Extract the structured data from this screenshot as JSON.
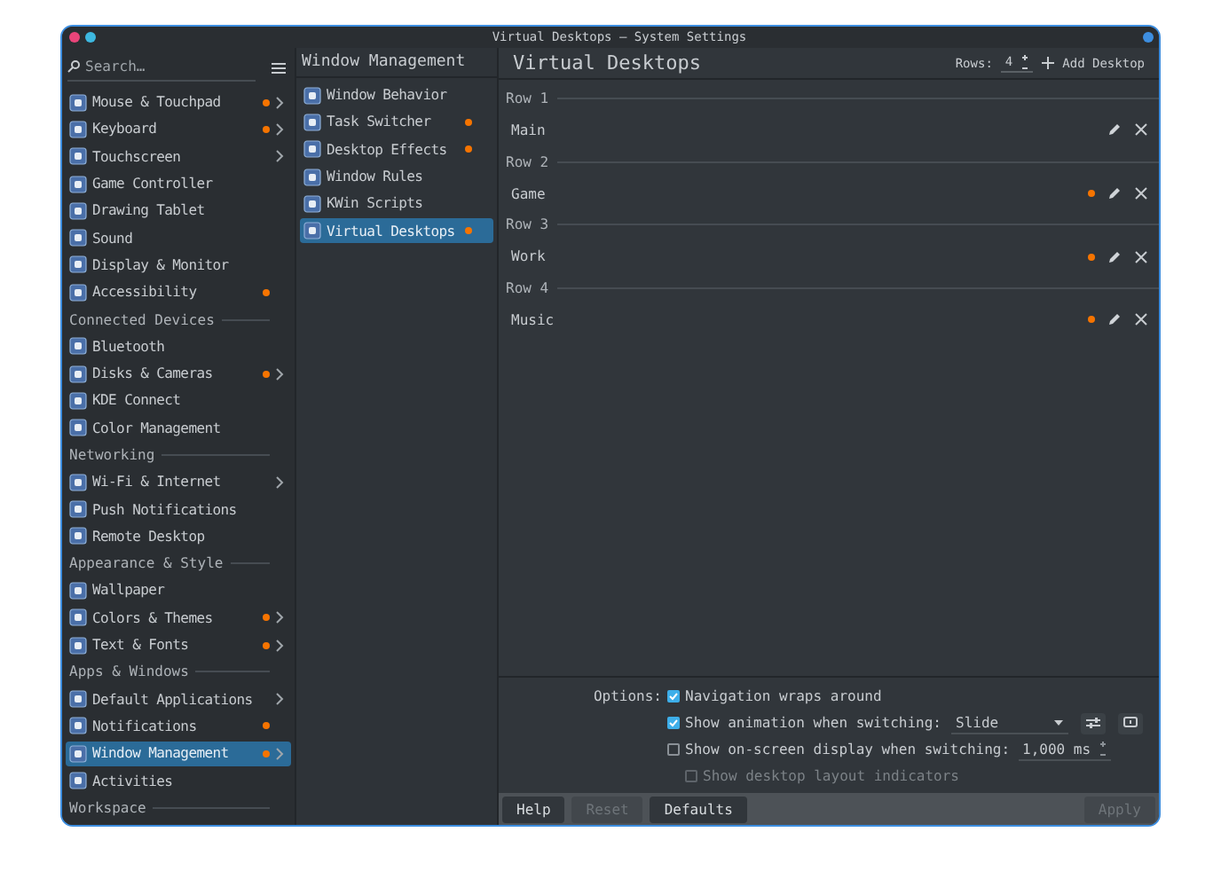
{
  "window": {
    "title": "Virtual Desktops — System Settings"
  },
  "sidebar": {
    "search": {
      "placeholder": "Search…"
    },
    "items": [
      {
        "kind": "item",
        "label": "Mouse & Touchpad",
        "modified": true,
        "arrow": true,
        "selected": false
      },
      {
        "kind": "item",
        "label": "Keyboard",
        "modified": true,
        "arrow": true,
        "selected": false
      },
      {
        "kind": "item",
        "label": "Touchscreen",
        "modified": false,
        "arrow": true,
        "selected": false
      },
      {
        "kind": "item",
        "label": "Game Controller",
        "modified": false,
        "arrow": false,
        "selected": false
      },
      {
        "kind": "item",
        "label": "Drawing Tablet",
        "modified": false,
        "arrow": false,
        "selected": false
      },
      {
        "kind": "item",
        "label": "Sound",
        "modified": false,
        "arrow": false,
        "selected": false
      },
      {
        "kind": "item",
        "label": "Display & Monitor",
        "modified": false,
        "arrow": false,
        "selected": false
      },
      {
        "kind": "item",
        "label": "Accessibility",
        "modified": true,
        "arrow": false,
        "selected": false
      },
      {
        "kind": "header",
        "label": "Connected Devices"
      },
      {
        "kind": "item",
        "label": "Bluetooth",
        "modified": false,
        "arrow": false,
        "selected": false
      },
      {
        "kind": "item",
        "label": "Disks & Cameras",
        "modified": true,
        "arrow": true,
        "selected": false
      },
      {
        "kind": "item",
        "label": "KDE Connect",
        "modified": false,
        "arrow": false,
        "selected": false
      },
      {
        "kind": "item",
        "label": "Color Management",
        "modified": false,
        "arrow": false,
        "selected": false
      },
      {
        "kind": "header",
        "label": "Networking"
      },
      {
        "kind": "item",
        "label": "Wi-Fi & Internet",
        "modified": false,
        "arrow": true,
        "selected": false
      },
      {
        "kind": "item",
        "label": "Push Notifications",
        "modified": false,
        "arrow": false,
        "selected": false
      },
      {
        "kind": "item",
        "label": "Remote Desktop",
        "modified": false,
        "arrow": false,
        "selected": false
      },
      {
        "kind": "header",
        "label": "Appearance & Style"
      },
      {
        "kind": "item",
        "label": "Wallpaper",
        "modified": false,
        "arrow": false,
        "selected": false
      },
      {
        "kind": "item",
        "label": "Colors & Themes",
        "modified": true,
        "arrow": true,
        "selected": false
      },
      {
        "kind": "item",
        "label": "Text & Fonts",
        "modified": true,
        "arrow": true,
        "selected": false
      },
      {
        "kind": "header",
        "label": "Apps & Windows"
      },
      {
        "kind": "item",
        "label": "Default Applications",
        "modified": false,
        "arrow": true,
        "selected": false
      },
      {
        "kind": "item",
        "label": "Notifications",
        "modified": true,
        "arrow": false,
        "selected": false
      },
      {
        "kind": "item",
        "label": "Window Management",
        "modified": true,
        "arrow": true,
        "selected": true
      },
      {
        "kind": "item",
        "label": "Activities",
        "modified": false,
        "arrow": false,
        "selected": false
      },
      {
        "kind": "header",
        "label": "Workspace"
      }
    ]
  },
  "subcategory": {
    "title": "Window Management",
    "items": [
      {
        "label": "Window Behavior",
        "modified": false,
        "selected": false
      },
      {
        "label": "Task Switcher",
        "modified": true,
        "selected": false
      },
      {
        "label": "Desktop Effects",
        "modified": true,
        "selected": false
      },
      {
        "label": "Window Rules",
        "modified": false,
        "selected": false
      },
      {
        "label": "KWin Scripts",
        "modified": false,
        "selected": false
      },
      {
        "label": "Virtual Desktops",
        "modified": true,
        "selected": true
      }
    ]
  },
  "main": {
    "title": "Virtual Desktops",
    "rows_label": "Rows:",
    "rows_value": "4",
    "add_label": "Add Desktop",
    "groups": [
      {
        "label": "Row 1",
        "desktops": [
          {
            "name": "Main",
            "modified": false
          }
        ]
      },
      {
        "label": "Row 2",
        "desktops": [
          {
            "name": "Game",
            "modified": true
          }
        ]
      },
      {
        "label": "Row 3",
        "desktops": [
          {
            "name": "Work",
            "modified": true
          }
        ]
      },
      {
        "label": "Row 4",
        "desktops": [
          {
            "name": "Music",
            "modified": true
          }
        ]
      }
    ],
    "options_label": "Options:",
    "options": [
      {
        "kind": "checkbox",
        "label": "Navigation wraps around",
        "checked": true,
        "disabled": false
      },
      {
        "kind": "combo",
        "label": "Show animation when switching:",
        "checked": true,
        "disabled": false,
        "value": "Slide"
      },
      {
        "kind": "spin",
        "label": "Show on-screen display when switching:",
        "checked": false,
        "disabled": false,
        "value": "1,000 ms"
      },
      {
        "kind": "indented",
        "label": "Show desktop layout indicators",
        "checked": false,
        "disabled": true
      }
    ]
  },
  "footer": {
    "buttons": [
      {
        "label": "Help",
        "disabled": false
      },
      {
        "label": "Reset",
        "disabled": true
      },
      {
        "label": "Defaults",
        "disabled": false
      },
      {
        "label": "Apply",
        "disabled": true
      }
    ]
  }
}
